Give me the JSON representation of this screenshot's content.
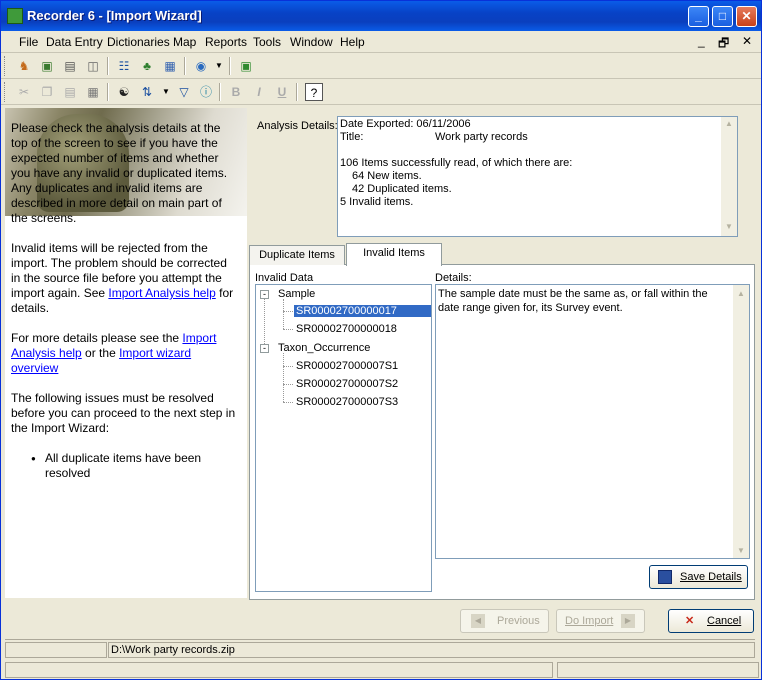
{
  "window": {
    "title": "Recorder 6 - [Import Wizard]",
    "controls": {
      "minimize": "_",
      "maximize": "□",
      "close": "✕"
    },
    "mdi_controls": {
      "minimize": "_",
      "restore": "🗗",
      "close": "✕"
    }
  },
  "menu": [
    "File",
    "Data Entry",
    "Dictionaries",
    "Map",
    "Reports",
    "Tools",
    "Window",
    "Help"
  ],
  "toolbar1": [
    "person-icon",
    "image-icon",
    "card-icon",
    "stack-icon",
    "network-icon",
    "tree-icon",
    "map-icon",
    "globe-icon",
    "dropdown-icon",
    "book-icon"
  ],
  "toolbar2": [
    "cut-icon",
    "copy-icon",
    "paste-icon",
    "report-icon",
    "binoculars-icon",
    "sort-icon",
    "dropdown-icon",
    "filter-icon",
    "info-icon",
    "bold-icon",
    "italic-icon",
    "underline-icon",
    "help-icon"
  ],
  "help": {
    "p1": "Please check the analysis details at the top of the screen to see if you have the expected number of items and whether you have any invalid or duplicated items. Any duplicates and invalid items are described in more detail on main part of the screens.",
    "p2_text": "Invalid items will be rejected from the import. The problem should be corrected in the source file before you attempt the import again. See ",
    "p2_link": "Import Analysis help",
    "p2_tail": " for details.",
    "p3_text": "For more details please see the ",
    "p3_link1": "Import Analysis help",
    "p3_mid": " or the ",
    "p3_link2": "Import wizard overview",
    "p4": "The following issues must be resolved before you can proceed to the next step in the Import Wizard:",
    "issues": [
      "All duplicate items have been resolved"
    ]
  },
  "analysis": {
    "label": "Analysis Details:",
    "date_exported": "Date Exported: 06/11/2006",
    "title_label": "Title:",
    "title_value": "Work party records",
    "summary": "106 Items successfully read, of which there are:",
    "new_items": "64 New items.",
    "dup_items": "42 Duplicated items.",
    "invalid_items": "5 Invalid items."
  },
  "tabs": [
    "Duplicate Items",
    "Invalid Items"
  ],
  "active_tab": 1,
  "invalid_panel": {
    "invalid_label": "Invalid Data",
    "details_label": "Details:",
    "tree": [
      {
        "label": "Sample",
        "children": [
          "SR00002700000017",
          "SR00002700000018"
        ]
      },
      {
        "label": "Taxon_Occurrence",
        "children": [
          "SR000027000007S1",
          "SR000027000007S2",
          "SR000027000007S3"
        ]
      }
    ],
    "details_text": "The sample date must be the same as, or fall within the date range given for, its Survey event.",
    "save_button": "Save Details"
  },
  "buttons": {
    "previous": "Previous",
    "import": "Do Import",
    "cancel": "Cancel"
  },
  "status": {
    "file": "D:\\Work party records.zip"
  }
}
